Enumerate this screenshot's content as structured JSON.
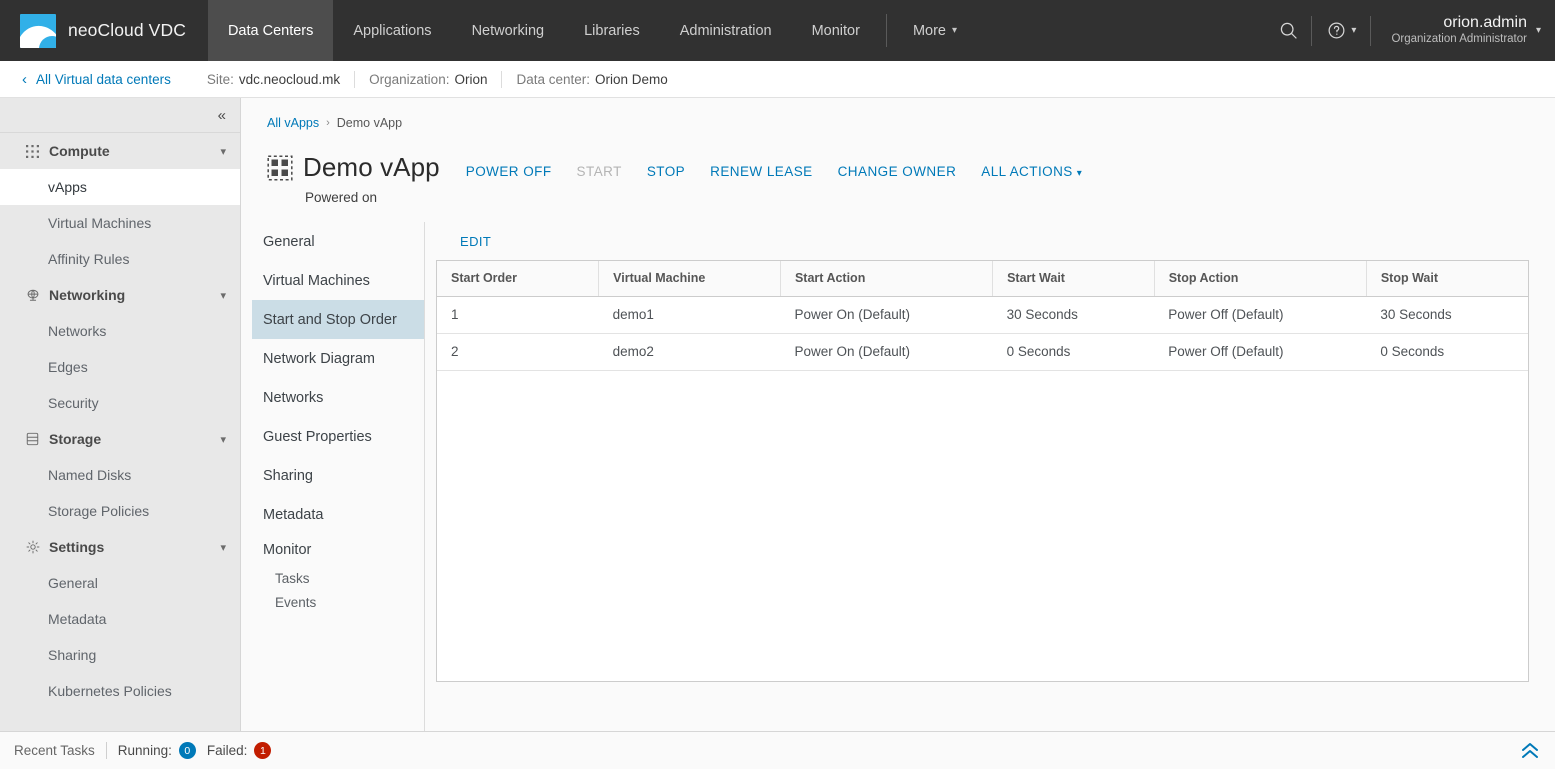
{
  "header": {
    "brand": "neoCloud VDC",
    "logo_icon": "cloud-logo-icon",
    "nav": [
      {
        "label": "Data Centers",
        "active": true
      },
      {
        "label": "Applications",
        "active": false
      },
      {
        "label": "Networking",
        "active": false
      },
      {
        "label": "Libraries",
        "active": false
      },
      {
        "label": "Administration",
        "active": false
      },
      {
        "label": "Monitor",
        "active": false
      }
    ],
    "more_label": "More",
    "search_icon": "search-icon",
    "help_icon": "help-icon",
    "user_name": "orion.admin",
    "user_role": "Organization Administrator"
  },
  "crumbbar": {
    "back_label": "All Virtual data centers",
    "pairs": [
      {
        "key": "Site:",
        "value": "vdc.neocloud.mk"
      },
      {
        "key": "Organization:",
        "value": "Orion"
      },
      {
        "key": "Data center:",
        "value": "Orion Demo"
      }
    ]
  },
  "sidebar": {
    "collapse_icon": "collapse-left-icon",
    "sections": [
      {
        "label": "Compute",
        "icon": "grid-icon",
        "items": [
          {
            "label": "vApps",
            "active": true
          },
          {
            "label": "Virtual Machines",
            "active": false
          },
          {
            "label": "Affinity Rules",
            "active": false
          }
        ]
      },
      {
        "label": "Networking",
        "icon": "network-icon",
        "items": [
          {
            "label": "Networks",
            "active": false
          },
          {
            "label": "Edges",
            "active": false
          },
          {
            "label": "Security",
            "active": false
          }
        ]
      },
      {
        "label": "Storage",
        "icon": "database-icon",
        "items": [
          {
            "label": "Named Disks",
            "active": false
          },
          {
            "label": "Storage Policies",
            "active": false
          }
        ]
      },
      {
        "label": "Settings",
        "icon": "gear-icon",
        "items": [
          {
            "label": "General",
            "active": false
          },
          {
            "label": "Metadata",
            "active": false
          },
          {
            "label": "Sharing",
            "active": false
          },
          {
            "label": "Kubernetes Policies",
            "active": false
          }
        ]
      }
    ]
  },
  "main": {
    "breadcrumb": {
      "root": "All vApps",
      "separator": "›",
      "current": "Demo vApp"
    },
    "vapp_icon": "vapp-grid-icon",
    "title": "Demo vApp",
    "status": "Powered on",
    "actions": [
      {
        "label": "POWER OFF",
        "disabled": false
      },
      {
        "label": "START",
        "disabled": true
      },
      {
        "label": "STOP",
        "disabled": false
      },
      {
        "label": "RENEW LEASE",
        "disabled": false
      },
      {
        "label": "CHANGE OWNER",
        "disabled": false
      },
      {
        "label": "ALL ACTIONS",
        "disabled": false,
        "caret": true
      }
    ],
    "inner_nav": [
      {
        "label": "General",
        "active": false,
        "type": "item"
      },
      {
        "label": "Virtual Machines",
        "active": false,
        "type": "item"
      },
      {
        "label": "Start and Stop Order",
        "active": true,
        "type": "item"
      },
      {
        "label": "Network Diagram",
        "active": false,
        "type": "item"
      },
      {
        "label": "Networks",
        "active": false,
        "type": "item"
      },
      {
        "label": "Guest Properties",
        "active": false,
        "type": "item"
      },
      {
        "label": "Sharing",
        "active": false,
        "type": "item"
      },
      {
        "label": "Metadata",
        "active": false,
        "type": "item"
      },
      {
        "label": "Monitor",
        "active": false,
        "type": "group"
      },
      {
        "label": "Tasks",
        "active": false,
        "type": "sub"
      },
      {
        "label": "Events",
        "active": false,
        "type": "sub"
      }
    ],
    "edit_label": "EDIT",
    "table": {
      "columns": [
        "Start Order",
        "Virtual Machine",
        "Start Action",
        "Start Wait",
        "Stop Action",
        "Stop Wait"
      ],
      "rows": [
        [
          "1",
          "demo1",
          "Power On (Default)",
          "30 Seconds",
          "Power Off (Default)",
          "30 Seconds"
        ],
        [
          "2",
          "demo2",
          "Power On (Default)",
          "0 Seconds",
          "Power Off (Default)",
          "0 Seconds"
        ]
      ]
    }
  },
  "footer": {
    "label": "Recent Tasks",
    "running_label": "Running:",
    "running_count": "0",
    "failed_label": "Failed:",
    "failed_count": "1",
    "expand_icon": "chevron-double-up-icon"
  },
  "colors": {
    "accent": "#0079b8",
    "header_bg": "#313131",
    "header_active_bg": "#4d4d4d",
    "sidebar_bg": "#e8e8e8",
    "selected_nav_bg": "#cbdde6",
    "badge_running": "#0079b8",
    "badge_failed": "#c21d00",
    "logo_blue": "#31b0e8"
  }
}
